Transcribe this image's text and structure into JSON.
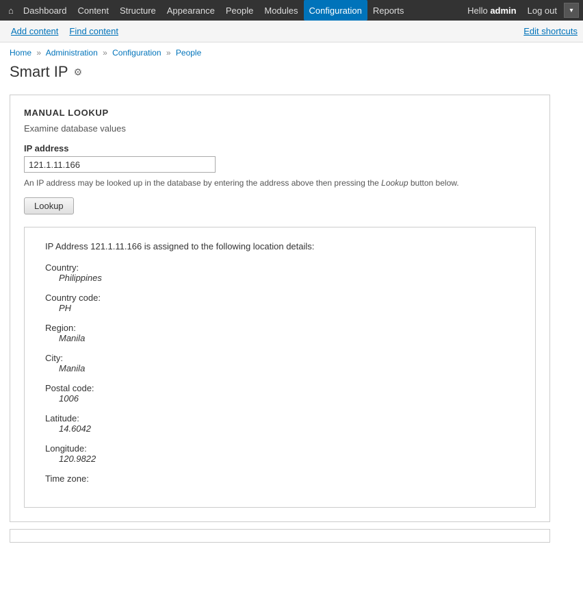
{
  "topNav": {
    "homeIcon": "⌂",
    "items": [
      {
        "label": "Dashboard",
        "name": "dashboard",
        "active": false
      },
      {
        "label": "Content",
        "name": "content",
        "active": false
      },
      {
        "label": "Structure",
        "name": "structure",
        "active": false
      },
      {
        "label": "Appearance",
        "name": "appearance",
        "active": false
      },
      {
        "label": "People",
        "name": "people",
        "active": false
      },
      {
        "label": "Modules",
        "name": "modules",
        "active": false
      },
      {
        "label": "Configuration",
        "name": "configuration",
        "active": true
      },
      {
        "label": "Reports",
        "name": "reports",
        "active": false
      }
    ],
    "helloPrefix": "Hello",
    "username": "admin",
    "logoutLabel": "Log out",
    "dropdownArrow": "▾"
  },
  "secondaryNav": {
    "addContent": "Add content",
    "findContent": "Find content",
    "editShortcuts": "Edit shortcuts"
  },
  "breadcrumb": {
    "items": [
      "Home",
      "Administration",
      "Configuration",
      "People"
    ],
    "separator": "»"
  },
  "pageTitle": {
    "title": "Smart IP",
    "settingsIcon": "⚙"
  },
  "panel": {
    "heading": "MANUAL LOOKUP",
    "subtitle": "Examine database values",
    "ipLabel": "IP address",
    "ipValue": "121.1.11.166",
    "helpText": "An IP address may be looked up in the database by entering the address above then pressing the",
    "helpLookupWord": "Lookup",
    "helpSuffix": "button below.",
    "lookupButton": "Lookup"
  },
  "results": {
    "header": "IP Address 121.1.11.166 is assigned to the following location details:",
    "rows": [
      {
        "label": "Country:",
        "value": "Philippines"
      },
      {
        "label": "Country code:",
        "value": "PH"
      },
      {
        "label": "Region:",
        "value": "Manila"
      },
      {
        "label": "City:",
        "value": "Manila"
      },
      {
        "label": "Postal code:",
        "value": "1006"
      },
      {
        "label": "Latitude:",
        "value": "14.6042"
      },
      {
        "label": "Longitude:",
        "value": "120.9822"
      },
      {
        "label": "Time zone:",
        "value": ""
      }
    ]
  }
}
